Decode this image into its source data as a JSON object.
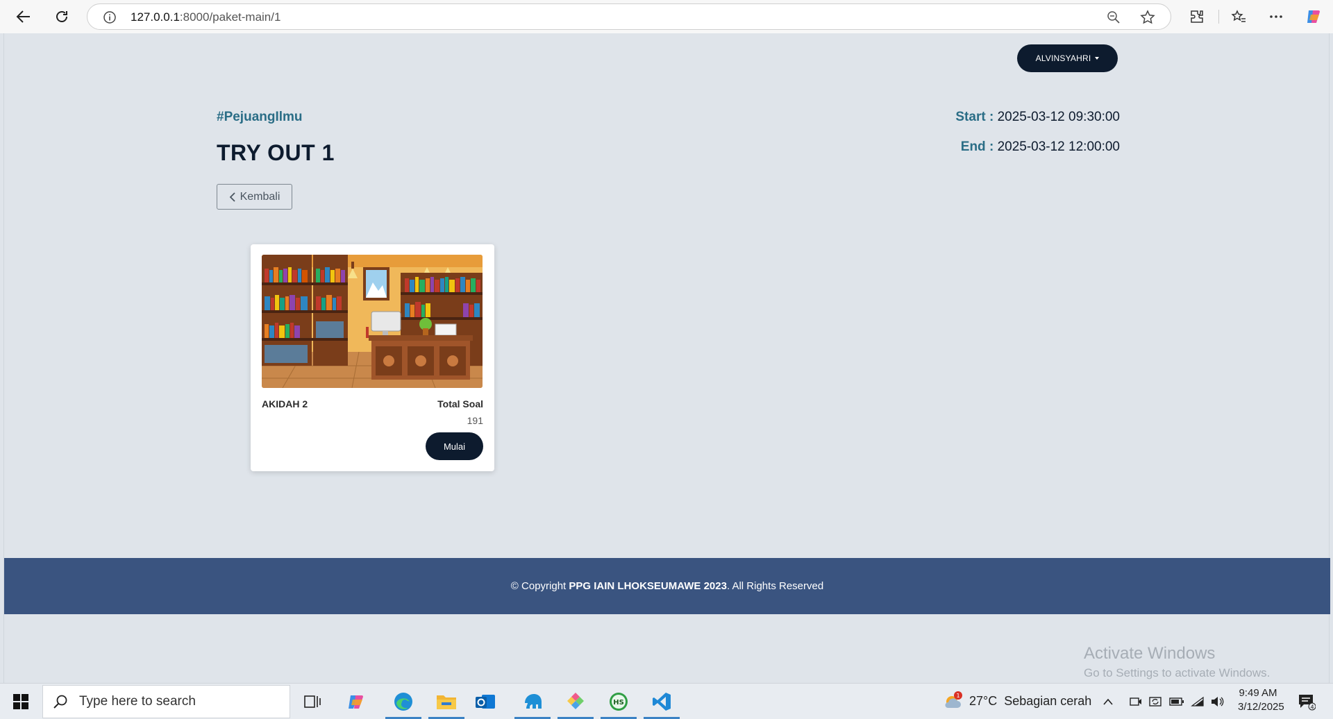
{
  "browser": {
    "url_host": "127.0.0.1",
    "url_rest": ":8000/paket-main/1"
  },
  "header": {
    "user_label": "ALVINSYAHRI",
    "hashtag": "#PejuangIlmu",
    "title": "TRY OUT 1",
    "back_label": "Kembali",
    "start_label": "Start :",
    "start_value": "2025-03-12 09:30:00",
    "end_label": "End :",
    "end_value": "2025-03-12 12:00:00"
  },
  "cards": [
    {
      "subject": "AKIDAH 2",
      "total_label": "Total Soal",
      "total_value": "191",
      "button_label": "Mulai",
      "image": "library-illustration"
    }
  ],
  "footer": {
    "prefix": "© Copyright ",
    "org": "PPG IAIN LHOKSEUMAWE 2023",
    "suffix": ". All Rights Reserved"
  },
  "watermark": {
    "line1": "Activate Windows",
    "line2": "Go to Settings to activate Windows."
  },
  "taskbar": {
    "search_placeholder": "Type here to search",
    "weather": "27°C  Sebagian cerah",
    "weather_badge": "1",
    "time": "9:49 AM",
    "date": "3/12/2025",
    "notification_count": "4"
  },
  "colors": {
    "navy": "#0d1b2e",
    "teal": "#2a6d86",
    "footer_blue": "#3a5480",
    "page_bg": "#dfe4ea"
  }
}
